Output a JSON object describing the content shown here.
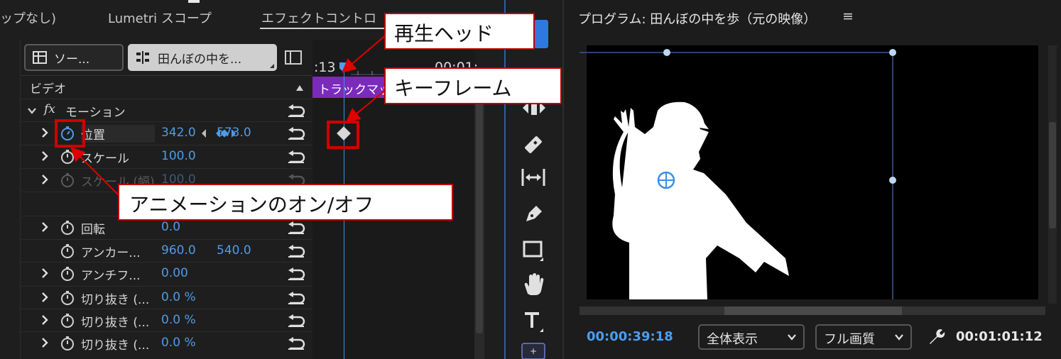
{
  "effect_panel": {
    "tabs": [
      {
        "label": "ップなし)"
      },
      {
        "label": "Lumetri スコープ"
      },
      {
        "label": "エフェクトコントロ"
      }
    ],
    "source_button": "ソー...",
    "clip_button": "田んぼの中を...",
    "section_label": "ビデオ",
    "group_label": "モーション",
    "fx_label": "fx",
    "ruler_time_1": ":13",
    "ruler_time_2": "00:01:",
    "track_matte_label": "トラックマッ",
    "rows": [
      {
        "label": "位置",
        "v1": "342.0",
        "v2": "573.0"
      },
      {
        "label": "スケール",
        "v1": "100.0",
        "v2": ""
      },
      {
        "label": "スケール (幅)",
        "v1": "100.0",
        "v2": ""
      },
      {
        "label": "",
        "v1": "",
        "v2": ""
      },
      {
        "label": "回転",
        "v1": "0.0",
        "v2": ""
      },
      {
        "label": "アンカー...",
        "v1": "960.0",
        "v2": "540.0"
      },
      {
        "label": "アンチフ...",
        "v1": "0.00",
        "v2": ""
      },
      {
        "label": "切り抜き (...",
        "v1": "0.0 %",
        "v2": ""
      },
      {
        "label": "切り抜き (...",
        "v1": "0.0 %",
        "v2": ""
      },
      {
        "label": "切り抜き (...",
        "v1": "0.0 %",
        "v2": ""
      }
    ]
  },
  "program_monitor": {
    "title": "プログラム: 田んぼの中を歩（元の映像）",
    "menu_glyph": "≡",
    "timecode_current": "00:00:39:18",
    "fit_dropdown": "全体表示",
    "quality_dropdown": "フル画質",
    "timecode_duration": "00:01:01:12"
  },
  "annotations": {
    "playhead": "再生ヘッド",
    "keyframe": "キーフレーム",
    "animation_toggle": "アニメーションのオン/オフ"
  },
  "colors": {
    "accent_blue": "#4f9be8",
    "track_matte_purple": "#7b2bbb",
    "annotation_red": "#c00000"
  }
}
